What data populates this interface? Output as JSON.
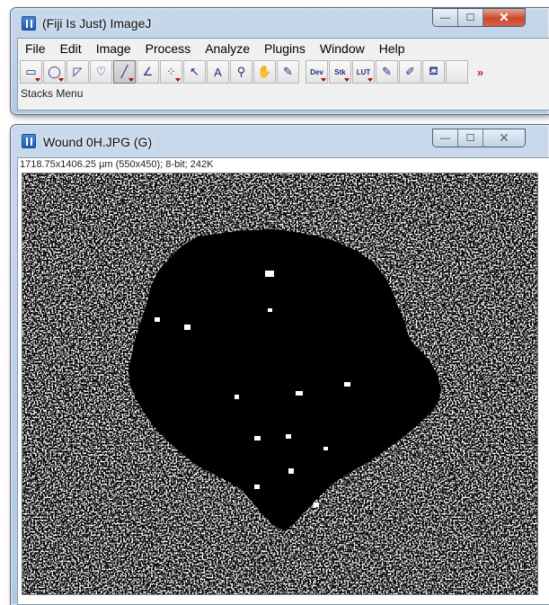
{
  "main_window": {
    "title": "(Fiji Is Just) ImageJ",
    "caption": {
      "minimize": "—",
      "maximize": "☐",
      "close": "✕"
    },
    "menu": [
      "File",
      "Edit",
      "Image",
      "Process",
      "Analyze",
      "Plugins",
      "Window",
      "Help"
    ],
    "tools": [
      {
        "name": "rectangle-tool",
        "icon": "▭",
        "dropdown": true
      },
      {
        "name": "oval-tool",
        "icon": "◯",
        "dropdown": true
      },
      {
        "name": "polygon-tool",
        "icon": "◸",
        "dropdown": false
      },
      {
        "name": "freehand-tool",
        "icon": "♡",
        "dropdown": false
      },
      {
        "name": "line-tool",
        "icon": "╱",
        "dropdown": true,
        "active": true
      },
      {
        "name": "angle-tool",
        "icon": "∠",
        "dropdown": false
      },
      {
        "name": "point-tool",
        "icon": "⁘",
        "dropdown": true
      },
      {
        "name": "wand-tool",
        "icon": "↖",
        "dropdown": false
      },
      {
        "name": "text-tool",
        "icon": "A",
        "dropdown": false
      },
      {
        "name": "magnifier-tool",
        "icon": "⚲",
        "dropdown": false
      },
      {
        "name": "hand-tool",
        "icon": "✋",
        "dropdown": false
      },
      {
        "name": "color-picker-tool",
        "icon": "✎",
        "dropdown": false
      }
    ],
    "extra_tools": [
      {
        "name": "dev-menu-tool",
        "label": "Dev",
        "dropdown": true
      },
      {
        "name": "stk-menu-tool",
        "label": "Stk",
        "dropdown": true
      },
      {
        "name": "lut-menu-tool",
        "label": "LUT",
        "dropdown": true
      },
      {
        "name": "pencil-tool",
        "label": "✎",
        "dropdown": false
      },
      {
        "name": "paintbrush-tool",
        "label": "✐",
        "dropdown": false
      },
      {
        "name": "flood-fill-tool",
        "label": "⛾",
        "dropdown": false
      }
    ],
    "more_tools": "»",
    "status": "Stacks Menu"
  },
  "image_window": {
    "title": "Wound 0H.JPG (G)",
    "caption": {
      "minimize": "—",
      "maximize": "☐",
      "close": "✕"
    },
    "info": "1718.75x1406.25 µm (550x450); 8-bit; 242K"
  }
}
